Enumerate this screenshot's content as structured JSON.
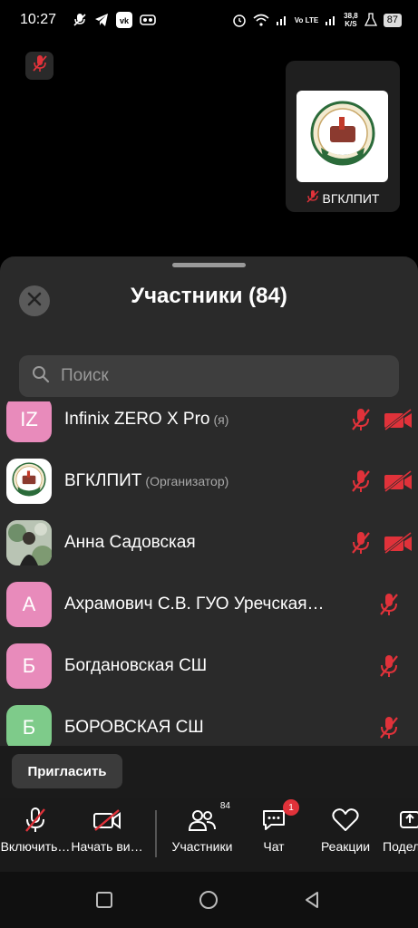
{
  "status_bar": {
    "time": "10:27",
    "speed_value": "38,8",
    "speed_unit": "K/S",
    "network_label": "Vo LTE",
    "battery": "87"
  },
  "video": {
    "self_tile_name": "ВГКЛПИТ"
  },
  "panel": {
    "title": "Участники (84)",
    "search_placeholder": "Поиск",
    "participants": [
      {
        "initials": "IZ",
        "name": "Infinix ZERO X Pro",
        "role": "(я)",
        "avatar_color": "#e88bbb",
        "mic_muted": true,
        "cam_off": true
      },
      {
        "initials": "",
        "name": "ВГКЛПИТ",
        "role": "(Организатор)",
        "avatar_color": "#ffffff",
        "avatar_type": "college-logo",
        "mic_muted": true,
        "cam_off": true
      },
      {
        "initials": "",
        "name": "Анна Садовская",
        "role": "",
        "avatar_color": "#9aa7a0",
        "avatar_type": "photo",
        "mic_muted": true,
        "cam_off": true
      },
      {
        "initials": "А",
        "name": "Ахрамович С.В. ГУО Уречская…",
        "role": "",
        "avatar_color": "#e88bbb",
        "mic_muted": true,
        "cam_off": false
      },
      {
        "initials": "Б",
        "name": "Богдановская СШ",
        "role": "",
        "avatar_color": "#e88bbb",
        "mic_muted": true,
        "cam_off": false
      },
      {
        "initials": "Б",
        "name": "БОРОВСКАЯ СШ",
        "role": "",
        "avatar_color": "#7ecb8a",
        "mic_muted": true,
        "cam_off": false
      }
    ],
    "invite_label": "Пригласить"
  },
  "toolbar": {
    "mic_label": "Включить…",
    "video_label": "Начать ви…",
    "participants_label": "Участники",
    "participants_count": "84",
    "chat_label": "Чат",
    "chat_badge": "1",
    "reactions_label": "Реакции",
    "share_label": "Подел"
  },
  "colors": {
    "muted_red": "#e0323a",
    "panel_bg": "#2a2a2a",
    "pink_avatar": "#e88bbb",
    "green_avatar": "#7ecb8a"
  }
}
